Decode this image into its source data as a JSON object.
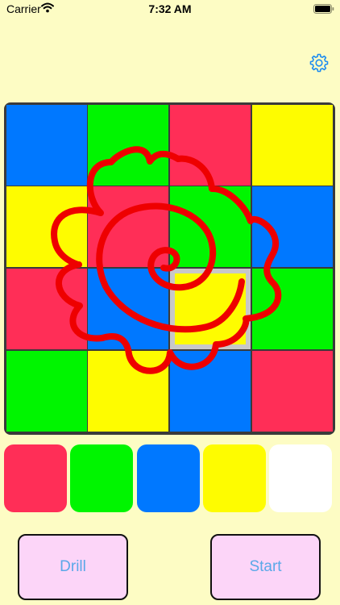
{
  "status_bar": {
    "carrier": "Carrier",
    "time": "7:32 AM"
  },
  "colors": {
    "red": "#ff2e57",
    "green": "#00f500",
    "blue": "#0078ff",
    "yellow": "#fefc00",
    "white": "#ffffff",
    "drawing": "#ee0000",
    "background": "#fdfcc4"
  },
  "board": {
    "rows": [
      [
        "blue",
        "green",
        "red",
        "yellow"
      ],
      [
        "yellow",
        "red",
        "green",
        "blue"
      ],
      [
        "red",
        "blue",
        "yellow",
        "green"
      ],
      [
        "green",
        "yellow",
        "blue",
        "red"
      ]
    ],
    "selected": {
      "row": 2,
      "col": 2
    }
  },
  "palette": [
    "red",
    "green",
    "blue",
    "yellow",
    "white"
  ],
  "buttons": {
    "drill_label": "Drill",
    "start_label": "Start"
  },
  "icons": {
    "settings": "gear-icon",
    "wifi": "wifi-icon",
    "battery": "battery-icon"
  }
}
